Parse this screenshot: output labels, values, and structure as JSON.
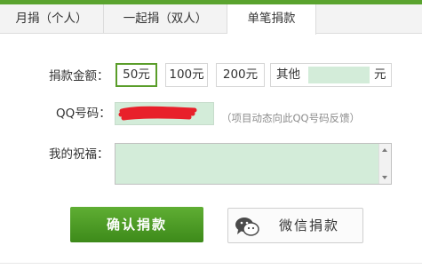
{
  "tabs": [
    {
      "label": "月捐（个人）"
    },
    {
      "label": "一起捐（双人）"
    },
    {
      "label": "单笔捐款"
    }
  ],
  "active_tab": "单笔捐款",
  "form": {
    "amount_label": "捐款金额：",
    "amounts": [
      "50元",
      "100元",
      "200元"
    ],
    "selected_amount": "50元",
    "other_label": "其他",
    "other_value": "",
    "other_unit": "元",
    "qq_label": "QQ号码：",
    "qq_value": "",
    "qq_hint": "（项目动态向此QQ号码反馈）",
    "wish_label": "我的祝福：",
    "wish_value": ""
  },
  "actions": {
    "confirm_label": "确认捐款",
    "wechat_label": "微信捐款"
  },
  "colors": {
    "accent_green": "#5aa32e",
    "input_bg": "#d3ecd9",
    "redaction": "#e8202a"
  },
  "icons": {
    "wechat": "wechat-icon"
  }
}
